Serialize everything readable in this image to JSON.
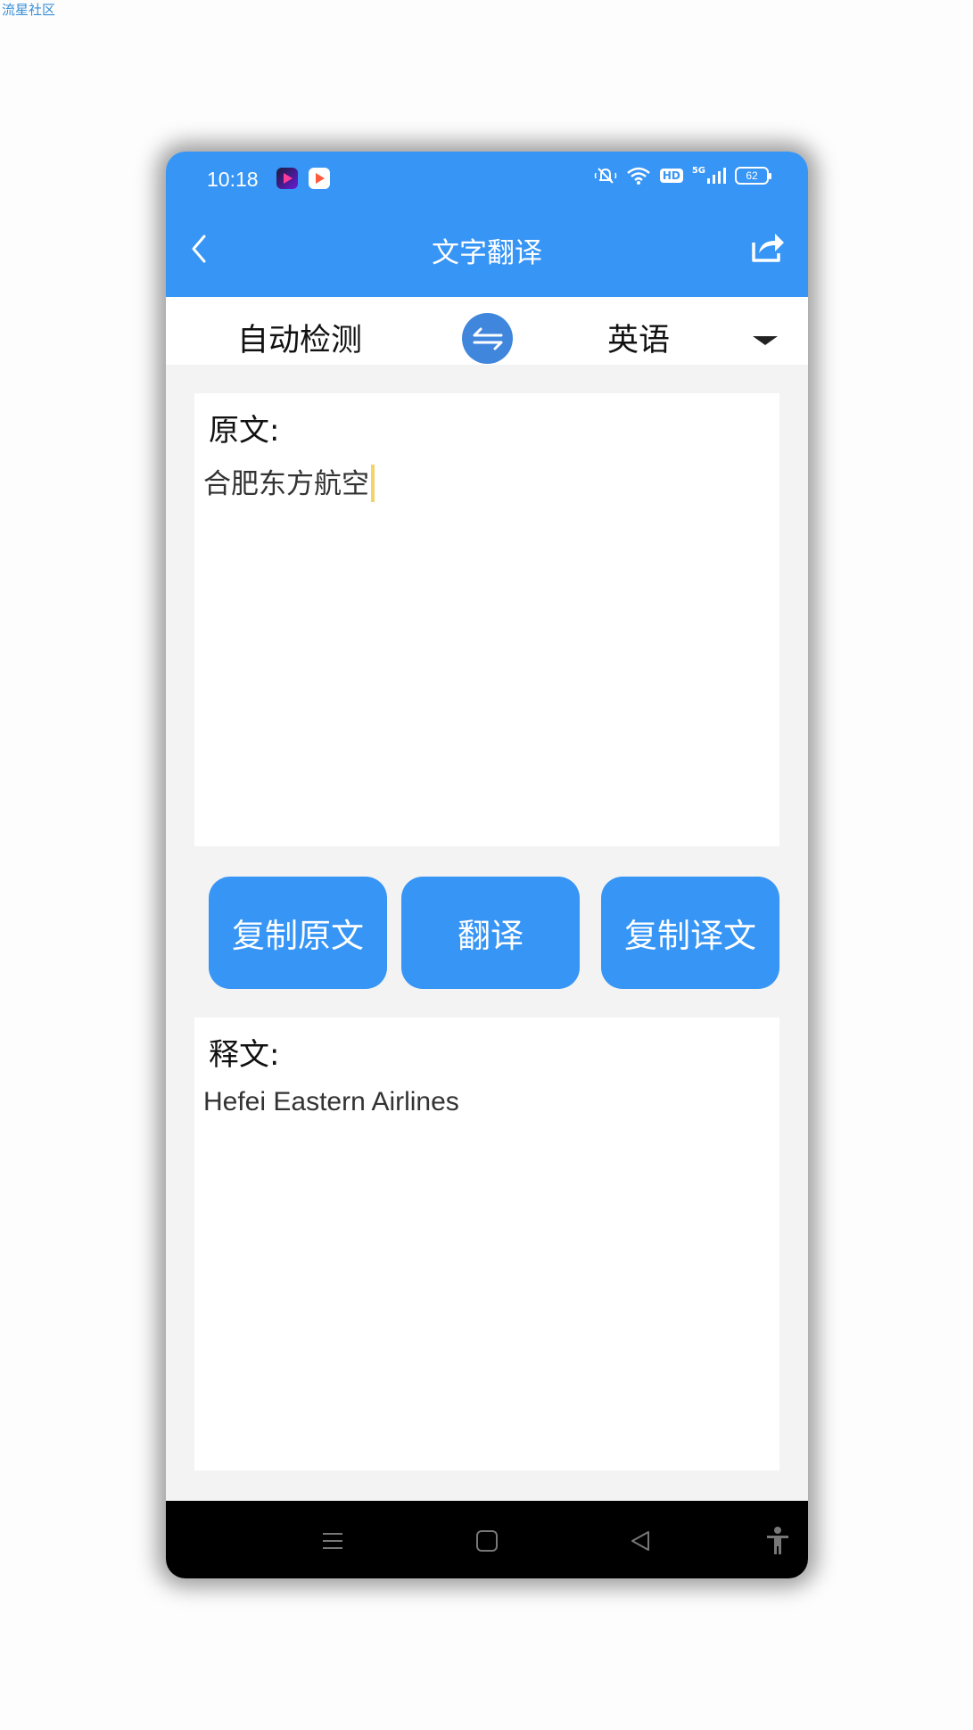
{
  "watermark": "流星社区",
  "status_bar": {
    "time": "10:18",
    "hd_label": "HD",
    "network_label": "5G",
    "battery": "62"
  },
  "nav": {
    "title": "文字翻译"
  },
  "languages": {
    "source": "自动检测",
    "target": "英语"
  },
  "source_panel": {
    "label": "原文:",
    "text": "合肥东方航空"
  },
  "buttons": {
    "copy_source": "复制原文",
    "translate": "翻译",
    "copy_result": "复制译文"
  },
  "result_panel": {
    "label": "释文:",
    "text": "Hefei Eastern Airlines"
  },
  "colors": {
    "accent": "#3795f5",
    "swap_button": "#3f86dc",
    "background": "#f3f3f3",
    "caret": "#f3d46a"
  }
}
